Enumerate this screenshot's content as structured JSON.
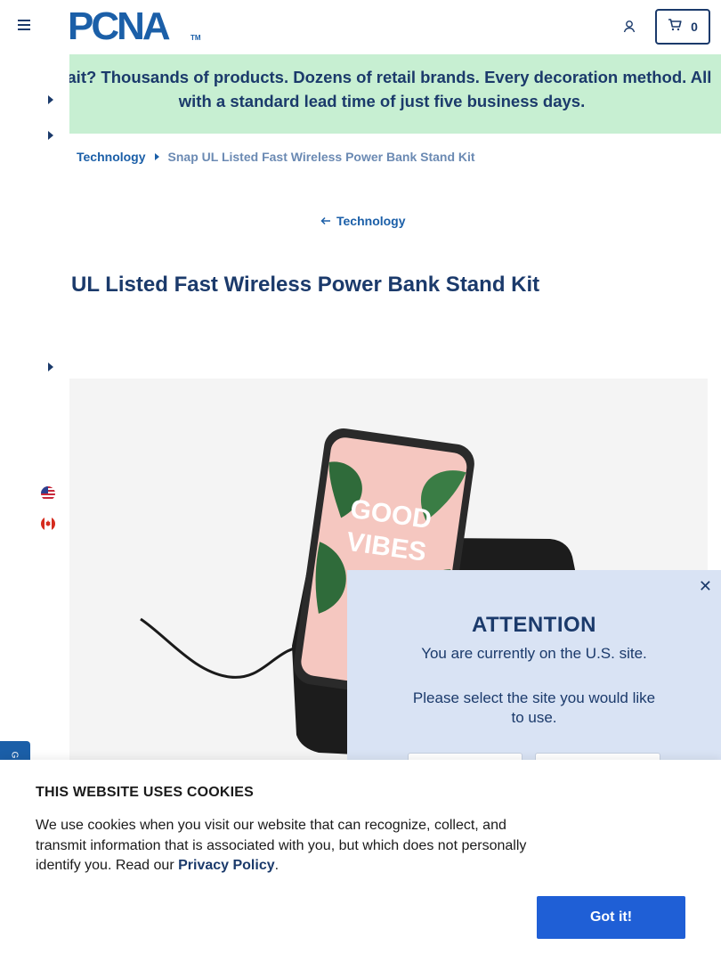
{
  "header": {
    "logo_text": "PCNA",
    "logo_tm": "TM",
    "cart_count": "0"
  },
  "banner": {
    "text": "Wait? Thousands of products. Dozens of retail brands. Every decoration method. All with a standard lead time of just five business days."
  },
  "breadcrumb": {
    "category": "Technology",
    "current": "Snap UL Listed Fast Wireless Power Bank Stand Kit"
  },
  "back_link": {
    "label": "Technology"
  },
  "product": {
    "title": "UL Listed Fast Wireless Power Bank Stand Kit",
    "image_text_1": "GOOD",
    "image_text_2": "VIBES"
  },
  "attention": {
    "title": "ATTENTION",
    "message": "You are currently on the U.S. site.",
    "prompt": "Please select the site you would like to use."
  },
  "side_tab": {
    "label": "G"
  },
  "cookie": {
    "title": "THIS WEBSITE USES COOKIES",
    "body_prefix": "We use cookies when you visit our website that can recognize, collect, and transmit information that is associated with you, but which does not personally identify you. Read our ",
    "privacy_link": "Privacy Policy",
    "body_suffix": ".",
    "button_label": "Got it!"
  },
  "colors": {
    "brand_blue": "#1b5fa8",
    "navy": "#1b3a6b",
    "banner_green": "#c7efd2",
    "button_blue": "#1f5fd6",
    "popup_bg": "#d9e3f4"
  }
}
